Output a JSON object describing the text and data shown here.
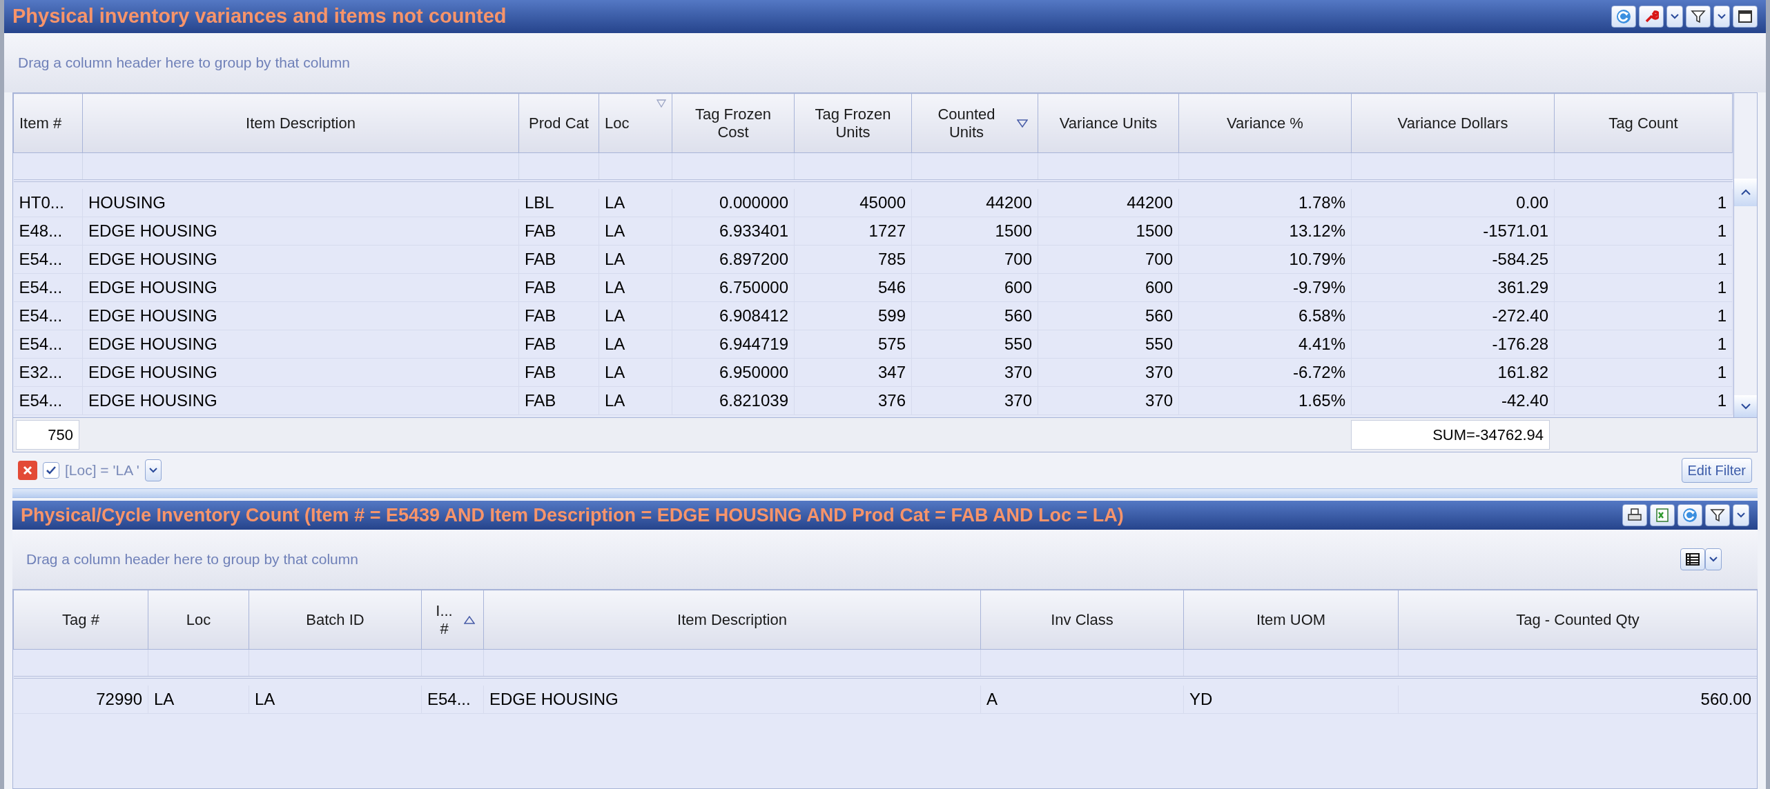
{
  "top_panel": {
    "title": "Physical inventory variances and items not counted",
    "group_hint": "Drag a column header here to group by that column",
    "columns": [
      {
        "label": "Item #",
        "sort_ascending": false,
        "sort_descending": false,
        "filtered": false
      },
      {
        "label": "Item Description",
        "sort_ascending": false,
        "sort_descending": false,
        "filtered": false
      },
      {
        "label": "Prod Cat",
        "sort_ascending": false,
        "sort_descending": false,
        "filtered": false
      },
      {
        "label": "Loc",
        "sort_ascending": false,
        "sort_descending": false,
        "filtered": true
      },
      {
        "label": "Tag Frozen Cost",
        "sort_ascending": false,
        "sort_descending": false,
        "filtered": false
      },
      {
        "label": "Tag Frozen Units",
        "sort_ascending": false,
        "sort_descending": false,
        "filtered": false
      },
      {
        "label": "Counted Units",
        "sort_ascending": false,
        "sort_descending": true,
        "filtered": false
      },
      {
        "label": "Variance Units",
        "sort_ascending": false,
        "sort_descending": false,
        "filtered": false
      },
      {
        "label": "Variance %",
        "sort_ascending": false,
        "sort_descending": false,
        "filtered": false
      },
      {
        "label": "Variance Dollars",
        "sort_ascending": false,
        "sort_descending": false,
        "filtered": false
      },
      {
        "label": "Tag Count",
        "sort_ascending": false,
        "sort_descending": false,
        "filtered": false
      }
    ],
    "rows": [
      [
        "HT0...",
        "HOUSING",
        "LBL",
        "LA",
        "0.000000",
        "45000",
        "44200",
        "44200",
        "1.78%",
        "0.00",
        "1"
      ],
      [
        "E48...",
        "EDGE HOUSING",
        "FAB",
        "LA",
        "6.933401",
        "1727",
        "1500",
        "1500",
        "13.12%",
        "-1571.01",
        "1"
      ],
      [
        "E54...",
        "EDGE HOUSING",
        "FAB",
        "LA",
        "6.897200",
        "785",
        "700",
        "700",
        "10.79%",
        "-584.25",
        "1"
      ],
      [
        "E54...",
        "EDGE HOUSING",
        "FAB",
        "LA",
        "6.750000",
        "546",
        "600",
        "600",
        "-9.79%",
        "361.29",
        "1"
      ],
      [
        "E54...",
        "EDGE HOUSING",
        "FAB",
        "LA",
        "6.908412",
        "599",
        "560",
        "560",
        "6.58%",
        "-272.40",
        "1"
      ],
      [
        "E54...",
        "EDGE HOUSING",
        "FAB",
        "LA",
        "6.944719",
        "575",
        "550",
        "550",
        "4.41%",
        "-176.28",
        "1"
      ],
      [
        "E32...",
        "EDGE HOUSING",
        "FAB",
        "LA",
        "6.950000",
        "347",
        "370",
        "370",
        "-6.72%",
        "161.82",
        "1"
      ],
      [
        "E54...",
        "EDGE HOUSING",
        "FAB",
        "LA",
        "6.821039",
        "376",
        "370",
        "370",
        "1.65%",
        "-42.40",
        "1"
      ]
    ],
    "footer": {
      "count": "750",
      "sum": "SUM=-34762.94"
    },
    "filter": {
      "enabled": true,
      "text": "[Loc] = 'LA '",
      "edit_button": "Edit Filter"
    }
  },
  "bottom_panel": {
    "title": "Physical/Cycle Inventory Count (Item # = E5439 AND Item Description = EDGE HOUSING AND Prod Cat = FAB AND Loc = LA)",
    "group_hint": "Drag a column header here to group by that column",
    "columns": [
      {
        "label": "Tag #",
        "sort_ascending": false,
        "sort_descending": false,
        "filtered": false
      },
      {
        "label": "Loc",
        "sort_ascending": false,
        "sort_descending": false,
        "filtered": false
      },
      {
        "label": "Batch ID",
        "sort_ascending": false,
        "sort_descending": false,
        "filtered": false
      },
      {
        "label": "I... #",
        "sort_ascending": true,
        "sort_descending": false,
        "filtered": false
      },
      {
        "label": "Item Description",
        "sort_ascending": false,
        "sort_descending": false,
        "filtered": false
      },
      {
        "label": "Inv Class",
        "sort_ascending": false,
        "sort_descending": false,
        "filtered": false
      },
      {
        "label": "Item UOM",
        "sort_ascending": false,
        "sort_descending": false,
        "filtered": false
      },
      {
        "label": "Tag - Counted Qty",
        "sort_ascending": false,
        "sort_descending": false,
        "filtered": false
      }
    ],
    "rows": [
      [
        "72990",
        "LA",
        "LA",
        "E54...",
        "EDGE HOUSING",
        "A",
        "YD",
        "560.00"
      ]
    ]
  }
}
